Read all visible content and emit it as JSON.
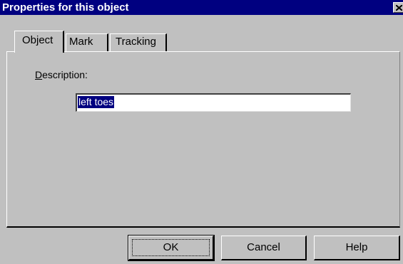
{
  "window": {
    "title": "Properties for this object",
    "close_glyph": "×"
  },
  "tabs": [
    {
      "label": "Object",
      "active": true
    },
    {
      "label": "Mark",
      "active": false
    },
    {
      "label": "Tracking",
      "active": false
    }
  ],
  "form": {
    "description_label_accel": "D",
    "description_label_rest": "escription:",
    "description_value": "left toes"
  },
  "buttons": {
    "ok": "OK",
    "cancel": "Cancel",
    "help": "Help"
  },
  "colors": {
    "titlebar": "#000080",
    "face": "#c0c0c0",
    "selection": "#000080"
  }
}
